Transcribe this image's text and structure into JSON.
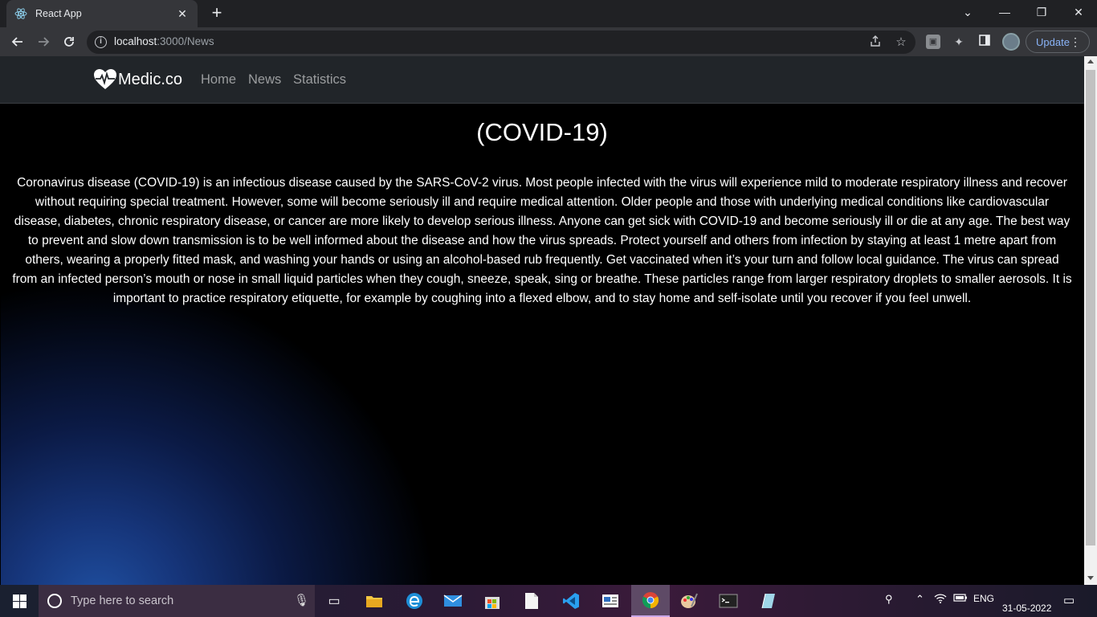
{
  "browser": {
    "tab_title": "React App",
    "tab_close": "✕",
    "new_tab": "+",
    "window_controls": {
      "dropdown": "⌄",
      "minimize": "—",
      "restore": "❐",
      "close": "✕"
    },
    "url_host": "localhost",
    "url_rest": ":3000/News",
    "update_label": "Update",
    "menu": "⋮"
  },
  "navbar": {
    "brand": "Medic.co",
    "links": [
      "Home",
      "News",
      "Statistics"
    ]
  },
  "article": {
    "title": "(COVID-19)",
    "body": "Coronavirus disease (COVID-19) is an infectious disease caused by the SARS-CoV-2 virus. Most people infected with the virus will experience mild to moderate respiratory illness and recover without requiring special treatment. However, some will become seriously ill and require medical attention. Older people and those with underlying medical conditions like cardiovascular disease, diabetes, chronic respiratory disease, or cancer are more likely to develop serious illness. Anyone can get sick with COVID-19 and become seriously ill or die at any age. The best way to prevent and slow down transmission is to be well informed about the disease and how the virus spreads. Protect yourself and others from infection by staying at least 1 metre apart from others, wearing a properly fitted mask, and washing your hands or using an alcohol-based rub frequently. Get vaccinated when it’s your turn and follow local guidance. The virus can spread from an infected person’s mouth or nose in small liquid particles when they cough, sneeze, speak, sing or breathe. These particles range from larger respiratory droplets to smaller aerosols. It is important to practice respiratory etiquette, for example by coughing into a flexed elbow, and to stay home and self-isolate until you recover if you feel unwell."
  },
  "taskbar": {
    "search_placeholder": "Type here to search",
    "language": "ENG",
    "date": "31-05-2022"
  },
  "colors": {
    "navbar_bg": "#212529",
    "nav_link": "#9b9d9f",
    "update_accent": "#8ab4f8"
  }
}
